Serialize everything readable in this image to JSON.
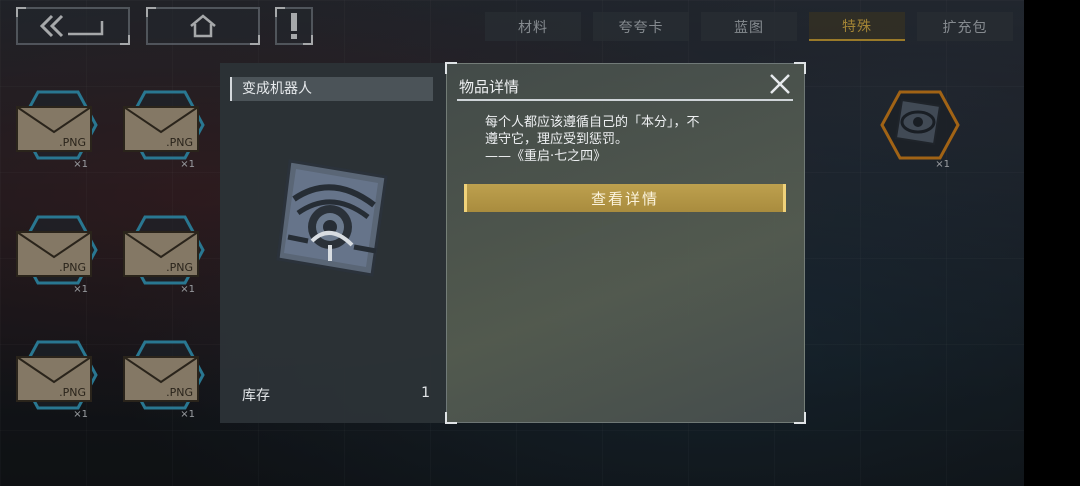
{
  "nav": {
    "back_icon": "double-chevron-left-icon",
    "home_icon": "house-icon",
    "alert_icon": "exclamation-icon"
  },
  "tabs": [
    {
      "label": "材料"
    },
    {
      "label": "夸夸卡"
    },
    {
      "label": "蓝图"
    },
    {
      "label": "特殊",
      "active": true
    },
    {
      "label": "扩充包"
    }
  ],
  "inventory": {
    "envelope_label": ".PNG",
    "count_label": "×1"
  },
  "dialog": {
    "item_name": "变成机器人",
    "stock_label": "库存",
    "stock_value": "1",
    "detail_title": "物品详情",
    "description_lines": [
      "每个人都应该遵循自己的「本分」，不",
      "遵守它，理应受到惩罚。",
      "——《重启·七之四》"
    ],
    "view_details_label": "查看详情",
    "close_icon": "close-x-icon"
  },
  "colors": {
    "accent_gold": "#d6a93a",
    "button_gold": "#b39647",
    "hex_blue": "#3aa6c9",
    "hex_orange": "#e08a1e"
  }
}
